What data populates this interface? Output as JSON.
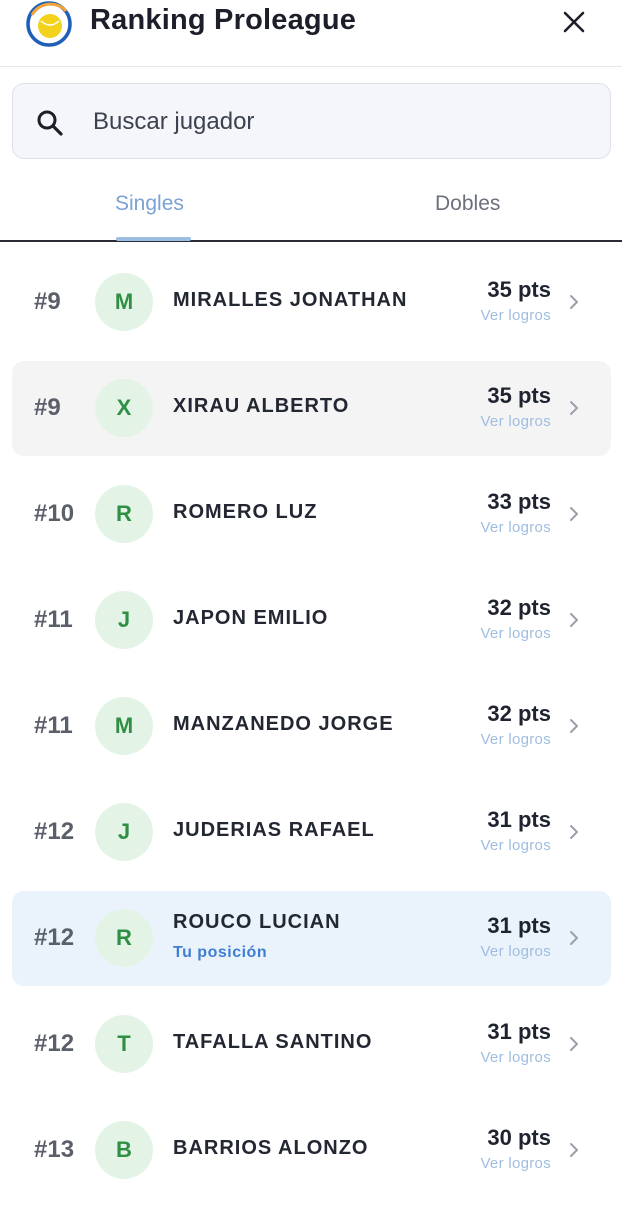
{
  "header": {
    "title": "Ranking Proleague",
    "logo_icon": "tennis-ball-icon",
    "close_icon": "close-icon"
  },
  "search": {
    "placeholder": "Buscar jugador",
    "value": "",
    "icon": "search-icon"
  },
  "tabs": [
    {
      "label": "Singles",
      "active": true
    },
    {
      "label": "Dobles",
      "active": false
    }
  ],
  "colors": {
    "accent_blue": "#7aa2d4",
    "avatar_green": "#2f8f45",
    "avatar_bg": "#e3f4e6",
    "highlight_grey": "#f4f4f5",
    "highlight_blue": "#eaf3fc",
    "you_label": "#3f7fd1"
  },
  "players": [
    {
      "rank": "#9",
      "initial": "M",
      "name": "MIRALLES JONATHAN",
      "points": "35 pts",
      "link": "Ver logros",
      "highlight": "none"
    },
    {
      "rank": "#9",
      "initial": "X",
      "name": "XIRAU ALBERTO",
      "points": "35 pts",
      "link": "Ver logros",
      "highlight": "grey"
    },
    {
      "rank": "#10",
      "initial": "R",
      "name": "ROMERO LUZ",
      "points": "33 pts",
      "link": "Ver logros",
      "highlight": "none"
    },
    {
      "rank": "#11",
      "initial": "J",
      "name": "JAPON EMILIO",
      "points": "32 pts",
      "link": "Ver logros",
      "highlight": "none"
    },
    {
      "rank": "#11",
      "initial": "M",
      "name": "MANZANEDO JORGE",
      "points": "32 pts",
      "link": "Ver logros",
      "highlight": "none"
    },
    {
      "rank": "#12",
      "initial": "J",
      "name": "JUDERIAS RAFAEL",
      "points": "31 pts",
      "link": "Ver logros",
      "highlight": "none"
    },
    {
      "rank": "#12",
      "initial": "R",
      "name": "ROUCO LUCIAN",
      "points": "31 pts",
      "link": "Ver logros",
      "highlight": "blue",
      "subtitle": "Tu posición"
    },
    {
      "rank": "#12",
      "initial": "T",
      "name": "TAFALLA SANTINO",
      "points": "31 pts",
      "link": "Ver logros",
      "highlight": "none"
    },
    {
      "rank": "#13",
      "initial": "B",
      "name": "BARRIOS ALONZO",
      "points": "30 pts",
      "link": "Ver logros",
      "highlight": "none"
    }
  ]
}
